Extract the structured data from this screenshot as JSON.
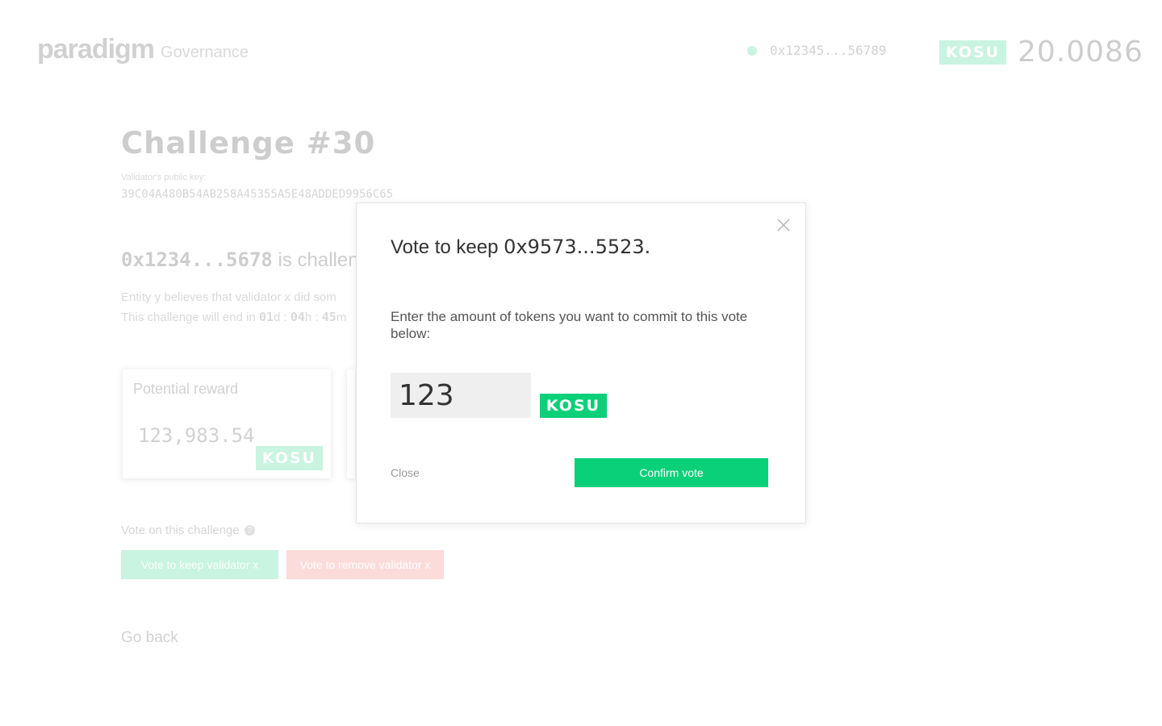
{
  "header": {
    "logo_text": "paradigm",
    "logo_subtitle": "Governance",
    "account_address": "0x12345...56789",
    "balance_token": "KOSU",
    "balance_value": "20.0086"
  },
  "challenge": {
    "title": "Challenge #30",
    "public_key_label": "Validator's public key:",
    "public_key": "39C04A480B54AB258A45355A5E48ADDED9956C65",
    "challenger": "0x1234...5678",
    "challenging_text": "is challengi",
    "description_visible": "Entity y believes that validator x did som",
    "countdown_prefix": "This challenge will end in",
    "countdown": {
      "days": "01",
      "days_unit": "d",
      "hours": "04",
      "hours_unit": "h",
      "minutes": "45",
      "minutes_unit": "m"
    }
  },
  "reward_card": {
    "label": "Potential reward",
    "value": "123,983.54",
    "token": "KOSU"
  },
  "vote_section": {
    "label": "Vote on this challenge",
    "help_symbol": "?",
    "keep_label": "Vote to keep validator x",
    "remove_label": "Vote to remove validator x"
  },
  "go_back_label": "Go back",
  "modal": {
    "title_prefix": "Vote to keep",
    "title_address": "0x9573...5523.",
    "instructions": "Enter the amount of tokens you want to commit to this vote below:",
    "amount_value": "123",
    "token": "KOSU",
    "close_label": "Close",
    "confirm_label": "Confirm vote"
  },
  "colors": {
    "accent_green": "#0bd07a",
    "danger_red": "#f26060"
  },
  "icons": {
    "status": "status-dot-icon",
    "close": "close-icon",
    "help": "help-icon"
  }
}
